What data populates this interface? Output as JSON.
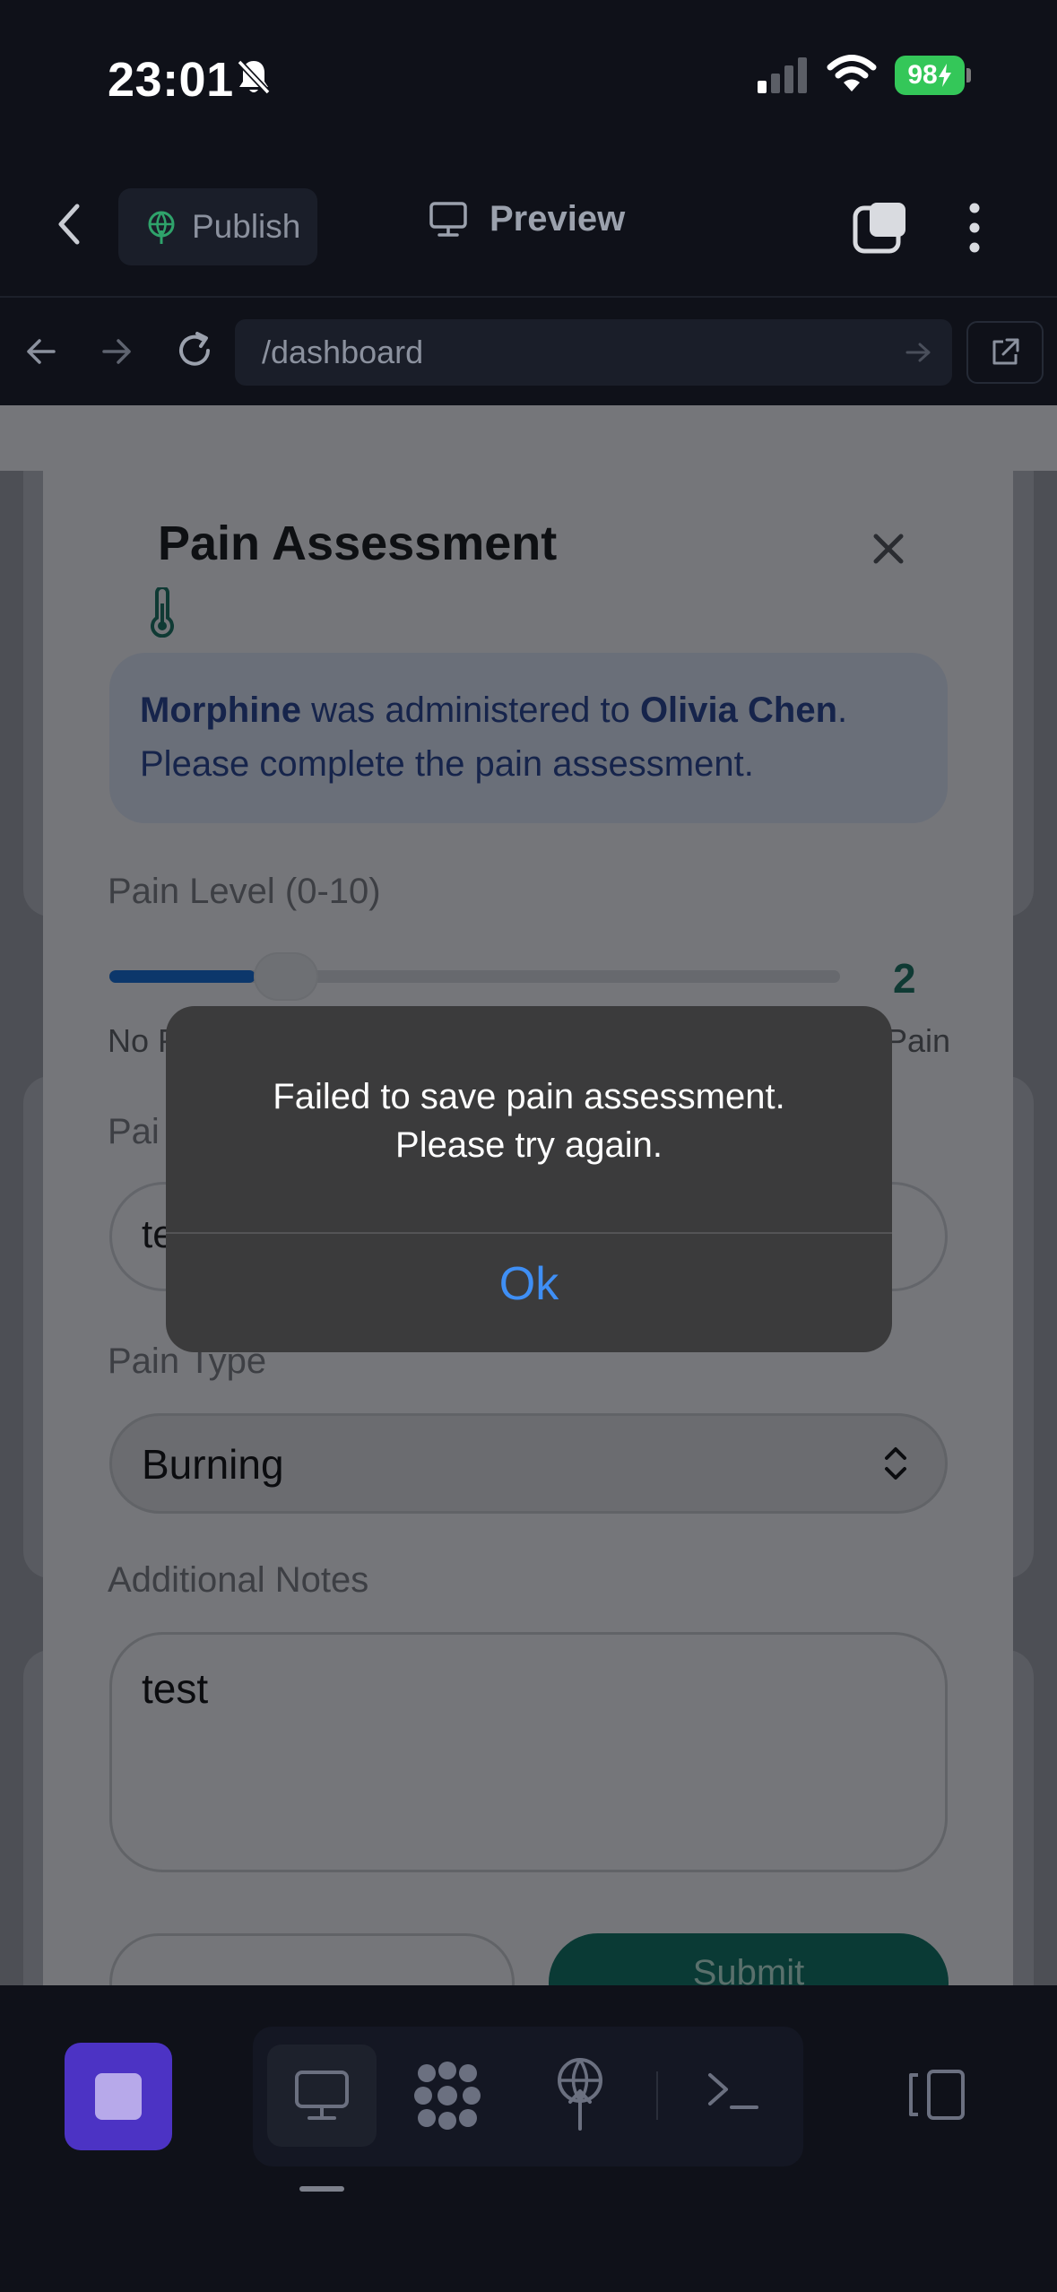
{
  "status_bar": {
    "time": "23:01",
    "battery": "98",
    "icons": [
      "bell-slash-icon",
      "cellular-signal-icon",
      "wifi-icon",
      "battery-charging-icon"
    ]
  },
  "toolbar": {
    "publish_label": "Publish",
    "preview_label": "Preview"
  },
  "browser": {
    "url": "/dashboard"
  },
  "modal": {
    "title": "Pain Assessment",
    "info": {
      "drug": "Morphine",
      "text_mid": " was administered to ",
      "patient": "Olivia Chen",
      "text_end": ".",
      "line2": "Please complete the pain assessment."
    },
    "pain_level_label": "Pain Level (0-10)",
    "pain_level_value": "2",
    "pain_level_numeric": 2,
    "pain_level_max": 10,
    "scale_min_label": "No P",
    "scale_max_label": "Pain",
    "location_label": "Pai",
    "location_value": "te",
    "pain_type_label": "Pain Type",
    "pain_type_value": "Burning",
    "notes_label": "Additional Notes",
    "notes_value": "test",
    "submit_label": "Submit"
  },
  "alert": {
    "message_line1": "Failed to save pain assessment.",
    "message_line2": "Please try again.",
    "ok_label": "Ok"
  },
  "colors": {
    "accent_purple": "#4c33c4",
    "alert_ok_blue": "#3f8ff5",
    "battery_green": "#34c759",
    "submit_teal": "#0a3a35"
  }
}
